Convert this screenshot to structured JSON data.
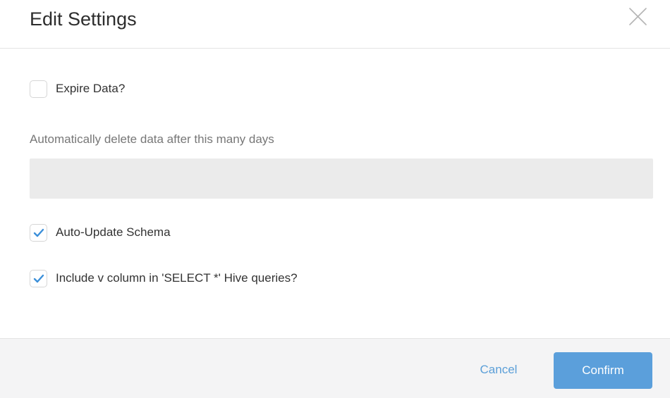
{
  "header": {
    "title": "Edit Settings",
    "close_icon": "close-icon"
  },
  "body": {
    "expire_data": {
      "label": "Expire Data?",
      "checked": false
    },
    "days_field": {
      "label": "Automatically delete data after this many days",
      "value": "",
      "placeholder": ""
    },
    "auto_update_schema": {
      "label": "Auto-Update Schema",
      "checked": true
    },
    "include_v_column": {
      "label": "Include v column in 'SELECT *' Hive queries?",
      "checked": true
    }
  },
  "footer": {
    "cancel_label": "Cancel",
    "confirm_label": "Confirm"
  },
  "colors": {
    "accent": "#5b9fdb",
    "check_tick": "#3b8fd9",
    "input_bg": "#ebebeb",
    "footer_bg": "#f4f4f5"
  }
}
